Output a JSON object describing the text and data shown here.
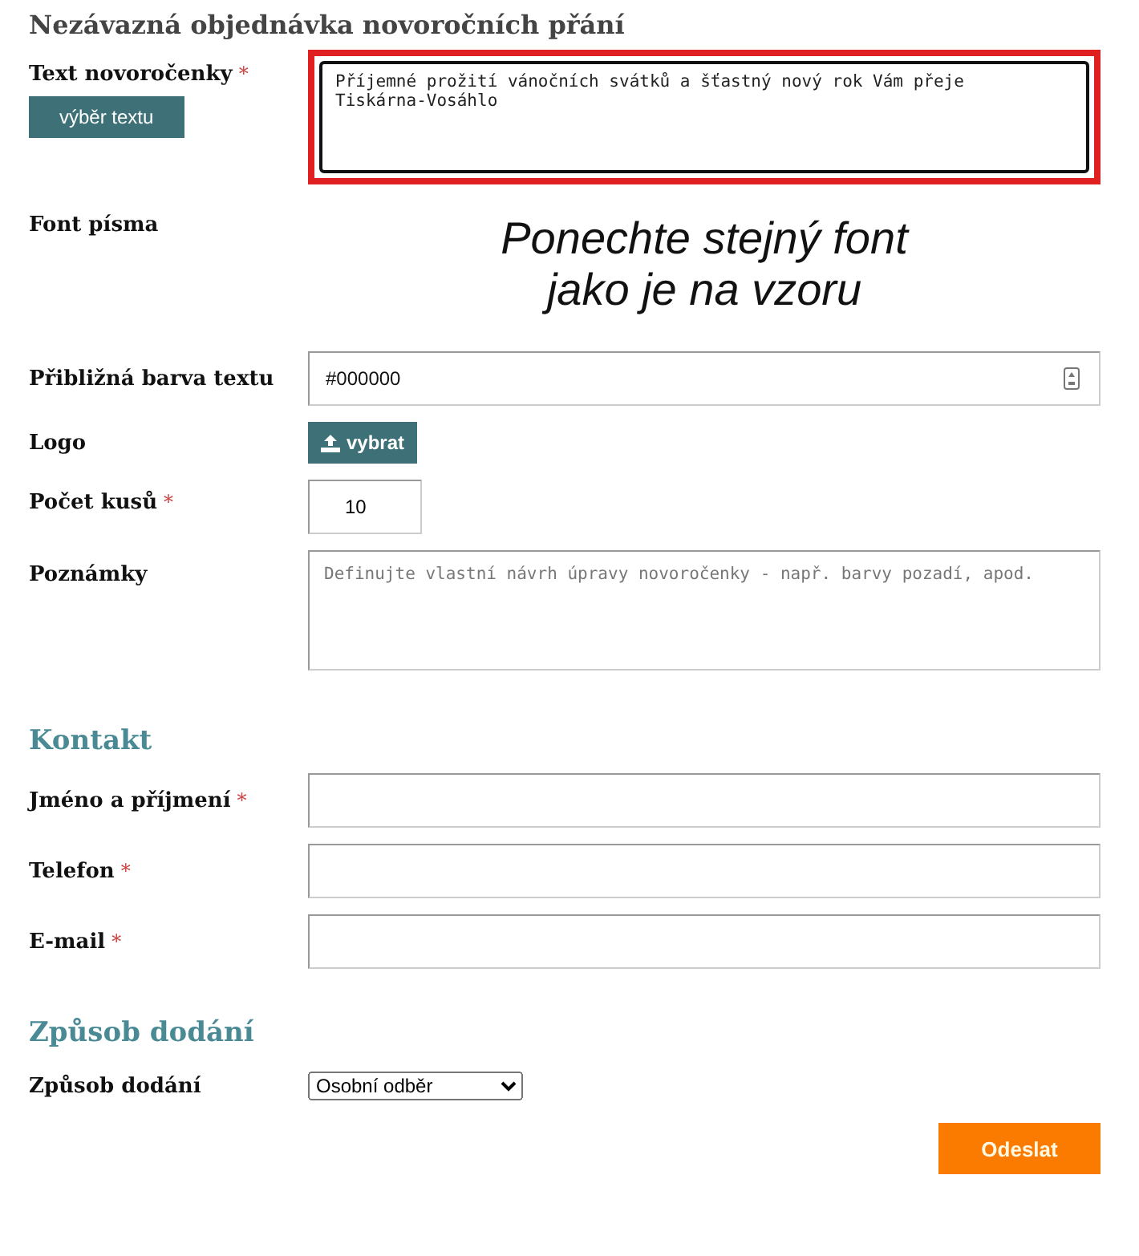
{
  "title": "Nezávazná objednávka novoročních přání",
  "sections": [
    {
      "rows": [
        {
          "kind": "message",
          "label": "Text novoročenky",
          "mark": "*",
          "value": "Příjemné prožití vánočních svátků a šťastný nový rok Vám přeje\nTiskárna-Vosáhlo",
          "button": "výběr textu"
        },
        {
          "kind": "note",
          "label": "Font písma",
          "note": "Ponechte stejný font\njako je na vzoru"
        },
        {
          "kind": "color",
          "label": "Přibližná barva textu",
          "value": "#000000"
        },
        {
          "kind": "upload",
          "label": "Logo",
          "button": "vybrat"
        },
        {
          "kind": "number",
          "label": "Počet kusů",
          "mark": "*",
          "value": "10"
        },
        {
          "kind": "textarea",
          "label": "Poznámky",
          "placeholder": "Definujte vlastní návrh úpravy novoročenky - např. barvy pozadí, apod."
        }
      ]
    },
    {
      "heading": "Kontakt",
      "rows": [
        {
          "kind": "text",
          "label": "Jméno a příjmení",
          "mark": "*"
        },
        {
          "kind": "text",
          "label": "Telefon",
          "mark": "*"
        },
        {
          "kind": "text",
          "label": "E-mail",
          "mark": "*"
        }
      ]
    },
    {
      "heading": "Způsob dodání",
      "rows": [
        {
          "kind": "select",
          "label": "Způsob dodání",
          "value": "Osobní odběr"
        }
      ]
    }
  ],
  "submit": "Odeslat"
}
